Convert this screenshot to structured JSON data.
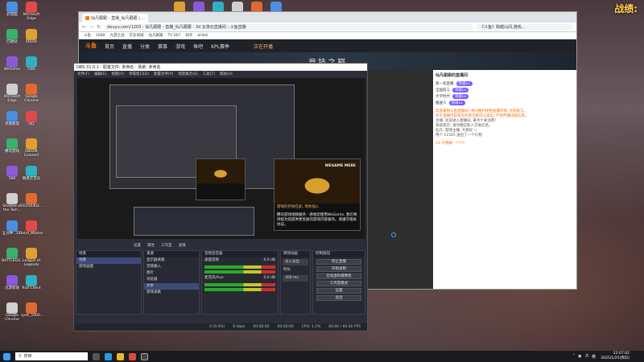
{
  "desktop": {
    "left_icons": [
      {
        "label": "此电脑"
      },
      {
        "label": "Microsoft Edge"
      },
      {
        "label": "回收站"
      },
      {
        "label": "Steam"
      },
      {
        "label": "WeGame"
      },
      {
        "label": "OBS"
      },
      {
        "label": "Microsoft Edge"
      },
      {
        "label": "Google Chrome"
      },
      {
        "label": "英雄联盟"
      },
      {
        "label": "QQ"
      },
      {
        "label": "腾讯游戏"
      },
      {
        "label": "Ubisoft Connect"
      },
      {
        "label": "360"
      },
      {
        "label": "网易云音乐"
      },
      {
        "label": "Shadow of the Tom..."
      },
      {
        "label": "20250402..."
      },
      {
        "label": "五分钟...DD"
      },
      {
        "label": "Intel_Master"
      },
      {
        "label": "BATTLEGR..."
      },
      {
        "label": "League of Legends"
      },
      {
        "label": "迅游加速"
      },
      {
        "label": "Riot Client"
      },
      {
        "label": "Google Chrome"
      },
      {
        "label": "syds_1000..."
      }
    ],
    "top_icons": [
      {
        "label": "Ubisoft Conn..."
      },
      {
        "label": "Steam"
      },
      {
        "label": "OBS Studio"
      },
      {
        "label": "腾讯加速器"
      },
      {
        "label": "英雄联盟"
      },
      {
        "label": "WeGame"
      }
    ],
    "corner_text": "战绩:"
  },
  "browser": {
    "tab_title": "仙凡跟跟 - 直播_仙凡跟跟 | ...",
    "url": "douyu.com/1203 - 仙凡跟跟 - 直播_仙凡跟跟 - 3d 云游云直播间 - 斗鱼直播",
    "search_hint": "《斗鱼》跨越山间,游戏...",
    "bookmarks": [
      "斗鱼",
      "1688",
      "九游之战",
      "京东商城",
      "仙凡跟跟",
      "TV 007",
      "知乎",
      "bilibili"
    ],
    "site_nav": {
      "logo": "斗鱼",
      "items": [
        "首页",
        "直播",
        "分类",
        "赛事",
        "游戏",
        "鱼吧",
        "KPL赛季"
      ],
      "live_text": "正在开播"
    },
    "banner_text": "竞技之巅",
    "chat": {
      "anchor_title": "仙凡跟跟的直播间",
      "rank_items": [
        {
          "name": "第一名直播",
          "badge": "等级Lv"
        },
        {
          "name": "全国前三",
          "badge": "等级Lv"
        },
        {
          "name": "大学时代",
          "badge": "等级Lv"
        },
        {
          "name": "推送人",
          "badge": "等级Lv"
        }
      ],
      "messages": [
        "欢迎来到斗鱼直播间! 共同维护绿色直播环境, 文明发言。",
        "对于直播内容有任何意见都可以提出, 严禁传播违规信息。",
        "主播: 欢迎进入直播间, 来点个关注吧!",
        "系统提示: 请勿相信私人交易信息。",
        "仙凡: 游戏主播, 大家好 ~",
        "用户 12345 送出了一个礼物"
      ],
      "bottom_msg": "CV 礼物刷: !!!!!!!"
    }
  },
  "obs": {
    "title": "OBS 31.0.1 - 配置文件: 未命名 - 场景: 未命名",
    "menu": [
      "文件(F)",
      "编辑(E)",
      "视图(V)",
      "停靠窗口(D)",
      "配置文件(P)",
      "场景集合(S)",
      "工具(T)",
      "帮助(H)"
    ],
    "popup": {
      "brand": "WEGAME MERE",
      "headline": "游戏的开始在此, 等你加入",
      "body": "腾讯游戏视频服务 · 感谢您使用WeGame, 我们将持续为您提供更优质的游戏内容服务。请遵守相关协议。"
    },
    "preview_bar": [
      "设置",
      "属性",
      "工作室",
      "滤镜"
    ],
    "scenes": {
      "header": "场景",
      "items": [
        "场景",
        "游戏画面"
      ]
    },
    "sources": {
      "header": "来源",
      "items": [
        "显示器采集",
        "音频输入",
        "图片",
        "浏览器",
        "文本",
        "游戏采集"
      ]
    },
    "mixer": {
      "header": "音频混音器",
      "channels": [
        {
          "name": "桌面音频",
          "db": "0.0 dB"
        },
        {
          "name": "麦克风/Aux",
          "db": "0.0 dB"
        }
      ]
    },
    "transitions": {
      "header": "转场动画",
      "value": "淡入淡出",
      "duration_label": "时长",
      "duration": "300 ms"
    },
    "controls": {
      "header": "控制按钮",
      "buttons": [
        "停止直播",
        "开始录制",
        "启动虚拟摄像机",
        "工作室模式",
        "设置",
        "退出"
      ]
    },
    "status": {
      "dropped": "0 (0.0%)",
      "kbps": "0 kbps",
      "live_time": "00:00:00",
      "rec_time": "00:00:00",
      "cpu": "CPU: 1.2%",
      "fps": "60.00 / 60.00 FPS"
    }
  },
  "taskbar": {
    "search_placeholder": "搜索",
    "tray_text": "英",
    "time": "22:07:02",
    "date": "2025/1/25(周日)"
  }
}
